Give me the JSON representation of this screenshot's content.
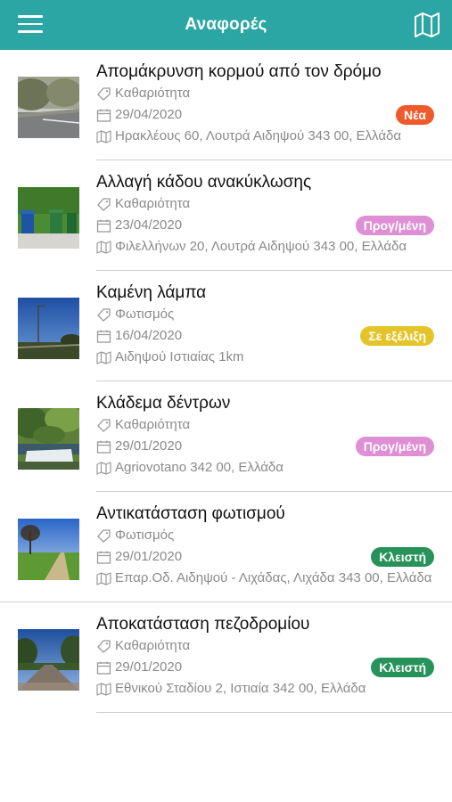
{
  "header": {
    "title": "Αναφορές",
    "menu_icon": "hamburger-menu-icon",
    "map_icon": "map-icon",
    "color": "#2ca6a4"
  },
  "reports": [
    {
      "title": "Απομάκρυνση κορμού από τον δρόμο",
      "category": "Καθαριότητα",
      "date": "29/04/2020",
      "status": "Νέα",
      "status_color": "#ee5a2c",
      "address": "Ηρακλέους 60, Λουτρά Αιδηψού 343 00, Ελλάδα"
    },
    {
      "title": "Αλλαγή κάδου ανακύκλωσης",
      "category": "Καθαριότητα",
      "date": "23/04/2020",
      "status": "Προγ/μένη",
      "status_color": "#df8fd4",
      "address": "Φιλελλήνων 20, Λουτρά Αιδηψού 343 00, Ελλάδα"
    },
    {
      "title": "Καμένη λάμπα",
      "category": "Φωτισμός",
      "date": "16/04/2020",
      "status": "Σε εξέλιξη",
      "status_color": "#e5c42a",
      "address": "Αιδηψού Ιστιαίας 1km"
    },
    {
      "title": "Κλάδεμα δέντρων",
      "category": "Καθαριότητα",
      "date": "29/01/2020",
      "status": "Προγ/μένη",
      "status_color": "#df8fd4",
      "address": "Agriovotano 342 00, Ελλάδα"
    },
    {
      "title": "Αντικατάσταση φωτισμού",
      "category": "Φωτισμός",
      "date": "29/01/2020",
      "status": "Κλειστή",
      "status_color": "#27935a",
      "address": "Επαρ.Οδ. Αιδηψού - Λιχάδας, Λιχάδα 343 00, Ελλάδα"
    },
    {
      "title": "Αποκατάσταση πεζοδρομίου",
      "category": "Καθαριότητα",
      "date": "29/01/2020",
      "status": "Κλειστή",
      "status_color": "#27935a",
      "address": "Εθνικού Σταδίου 2, Ιστιαία 342 00, Ελλάδα"
    }
  ]
}
